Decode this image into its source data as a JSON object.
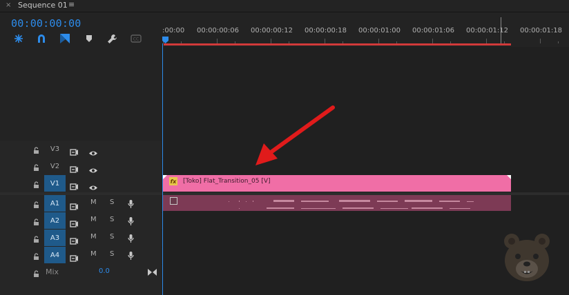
{
  "panel": {
    "close": "×",
    "title": "Sequence 01",
    "menu": "≡"
  },
  "timecode": "00:00:00:00",
  "tools": [
    "snap-icon",
    "linked-selection-icon",
    "add-marker-icon",
    "marker-icon",
    "settings-wrench-icon",
    "captions-icon"
  ],
  "ruler": {
    "labels": [
      ":00:00",
      "00:00:00:06",
      "00:00:00:12",
      "00:00:00:18",
      "00:00:01:00",
      "00:00:01:06",
      "00:00:01:12",
      "00:00:01:18"
    ]
  },
  "tracks": {
    "video": [
      {
        "name": "V3",
        "active": false
      },
      {
        "name": "V2",
        "active": false
      },
      {
        "name": "V1",
        "active": true
      }
    ],
    "audio": [
      {
        "name": "A1",
        "m": "M",
        "s": "S"
      },
      {
        "name": "A2",
        "m": "M",
        "s": "S"
      },
      {
        "name": "A3",
        "m": "M",
        "s": "S"
      },
      {
        "name": "A4",
        "m": "M",
        "s": "S"
      }
    ],
    "mix": {
      "label": "Mix",
      "value": "0.0"
    }
  },
  "clip": {
    "fx": "fx",
    "label": "[Toko] Flat_Transition_05 [V]",
    "color_video": "#f06ea6",
    "color_audio": "#7d3a55"
  },
  "colors": {
    "accent": "#2d8ceb",
    "workarea": "#d23a3a",
    "annotation_arrow": "#e01b1b"
  }
}
